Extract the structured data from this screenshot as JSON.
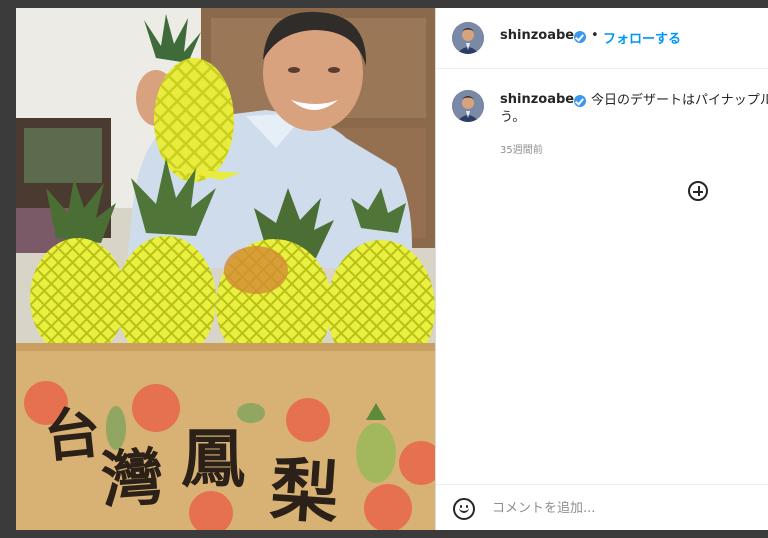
{
  "post": {
    "username": "shinzoabe",
    "separator": "•",
    "follow_label": "フォローする",
    "caption_line1": "今日のデザートはパイナップル",
    "caption_line2": "う。",
    "time_ago": "35週間前",
    "comment_placeholder": "コメントを追加..."
  },
  "photo": {
    "box_text": [
      "台",
      "灣",
      "鳳",
      "梨"
    ]
  },
  "colors": {
    "accent": "#0095f6",
    "verified": "#3897f0",
    "text": "#262626",
    "muted": "#8e8e8e"
  },
  "icons": [
    "verified-badge-icon",
    "add-icon",
    "emoji-icon"
  ]
}
